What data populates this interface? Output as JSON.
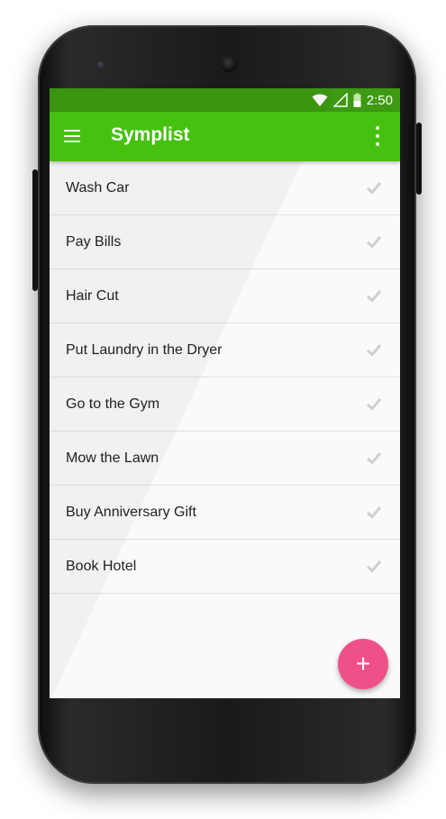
{
  "status_bar": {
    "time": "2:50",
    "icons": [
      "wifi-icon",
      "signal-icon",
      "battery-icon"
    ]
  },
  "app_bar": {
    "title": "Symplist",
    "menu_icon": "hamburger-menu-icon",
    "overflow_icon": "more-vert-icon"
  },
  "tasks": [
    {
      "label": "Wash Car"
    },
    {
      "label": "Pay Bills"
    },
    {
      "label": "Hair Cut"
    },
    {
      "label": "Put Laundry in the Dryer"
    },
    {
      "label": "Go to the Gym"
    },
    {
      "label": "Mow the Lawn"
    },
    {
      "label": "Buy Anniversary Gift"
    },
    {
      "label": "Book Hotel"
    }
  ],
  "fab": {
    "icon": "plus-icon",
    "glyph": "+"
  },
  "colors": {
    "app_bar": "#46c10f",
    "status_bar": "#3d9a12",
    "fab": "#f0508a",
    "check": "#cfcfcf"
  }
}
